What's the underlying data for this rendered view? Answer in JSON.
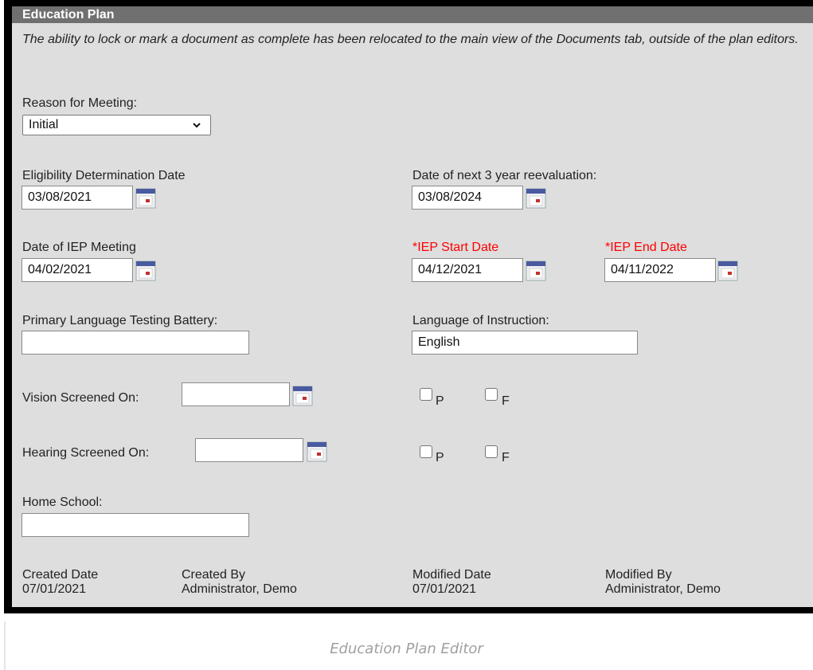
{
  "header": {
    "title": "Education Plan"
  },
  "note": "The ability to lock or mark a document as complete has been relocated to the main view of the Documents tab, outside of the plan editors.",
  "reason": {
    "label": "Reason for Meeting:",
    "value": "Initial"
  },
  "eligibility": {
    "label": "Eligibility Determination Date",
    "value": "03/08/2021"
  },
  "reeval": {
    "label": "Date of next 3 year reevaluation:",
    "value": "03/08/2024"
  },
  "iep_meeting": {
    "label": "Date of IEP Meeting",
    "value": "04/02/2021"
  },
  "iep_start": {
    "label": "*IEP Start Date",
    "value": "04/12/2021"
  },
  "iep_end": {
    "label": "*IEP End Date",
    "value": "04/11/2022"
  },
  "testing_battery": {
    "label": "Primary Language Testing Battery:",
    "value": ""
  },
  "instruction_language": {
    "label": "Language of Instruction:",
    "value": "English"
  },
  "vision": {
    "label": "Vision Screened On:",
    "value": "",
    "pass_label": "P",
    "fail_label": "F"
  },
  "hearing": {
    "label": "Hearing Screened On:",
    "value": "",
    "pass_label": "P",
    "fail_label": "F"
  },
  "home_school": {
    "label": "Home School:",
    "value": ""
  },
  "footer": {
    "created_date_label": "Created Date",
    "created_date": "07/01/2021",
    "created_by_label": "Created By",
    "created_by": "Administrator, Demo",
    "modified_date_label": "Modified Date",
    "modified_date": "07/01/2021",
    "modified_by_label": "Modified By",
    "modified_by": "Administrator, Demo"
  },
  "caption": "Education Plan Editor",
  "icons": {
    "calendar": "calendar-icon",
    "dropdown": "chevron-down-icon"
  },
  "colors": {
    "header_bg": "#707070",
    "panel_bg": "#dedede",
    "required": "#ff0000"
  }
}
